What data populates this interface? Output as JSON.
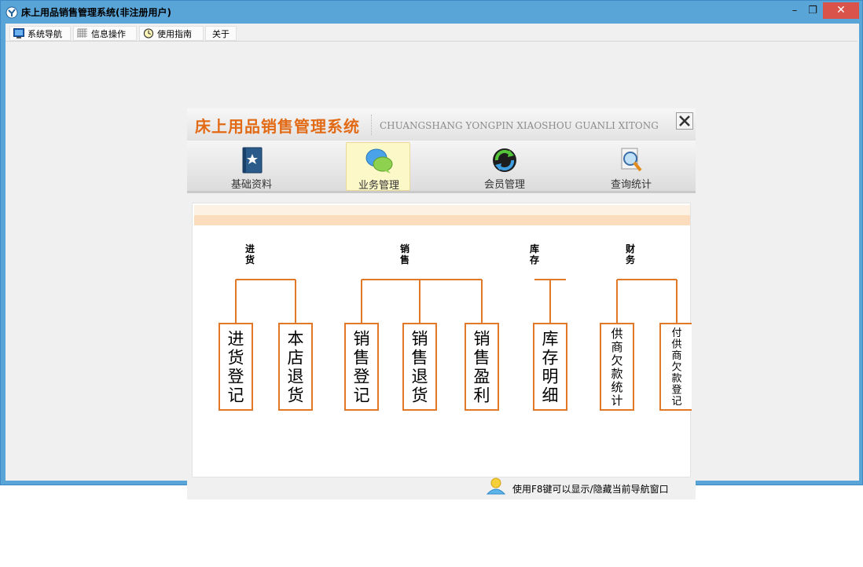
{
  "window": {
    "title": "床上用品销售管理系统(非注册用户)",
    "minimize": "–",
    "restore": "❐",
    "close": "✕"
  },
  "menu": [
    {
      "label": "系统导航",
      "icon": "monitor-icon"
    },
    {
      "label": "信息操作",
      "icon": "grid-icon"
    },
    {
      "label": "使用指南",
      "icon": "clock-icon"
    },
    {
      "label": "关于",
      "icon": ""
    }
  ],
  "panel": {
    "title": "床上用品销售管理系统",
    "subtitle": "CHUANGSHANG YONGPIN XIAOSHOU GUANLI XITONG",
    "close": "✕"
  },
  "tabs": [
    {
      "label": "基础资料",
      "icon": "book-icon",
      "active": false
    },
    {
      "label": "业务管理",
      "icon": "chat-bubbles-icon",
      "active": true
    },
    {
      "label": "会员管理",
      "icon": "refresh-globe-icon",
      "active": false
    },
    {
      "label": "查询统计",
      "icon": "magnifier-icon",
      "active": false
    }
  ],
  "tree": {
    "groups": [
      {
        "label": "进货",
        "items": [
          "进货登记",
          "本店退货"
        ]
      },
      {
        "label": "销售",
        "items": [
          "销售登记",
          "销售退货",
          "销售盈利"
        ]
      },
      {
        "label": "库存",
        "items": [
          "库存明细"
        ]
      },
      {
        "label": "财务",
        "items": [
          "供商欠款统计",
          "付供商欠款登记"
        ]
      }
    ]
  },
  "status": {
    "hint": "使用F8键可以显示/隐藏当前导航窗口"
  },
  "colors": {
    "accent": "#e36a14",
    "titlebar": "#5aa5d8",
    "close": "#d9534a",
    "tree_line": "#e07828"
  }
}
